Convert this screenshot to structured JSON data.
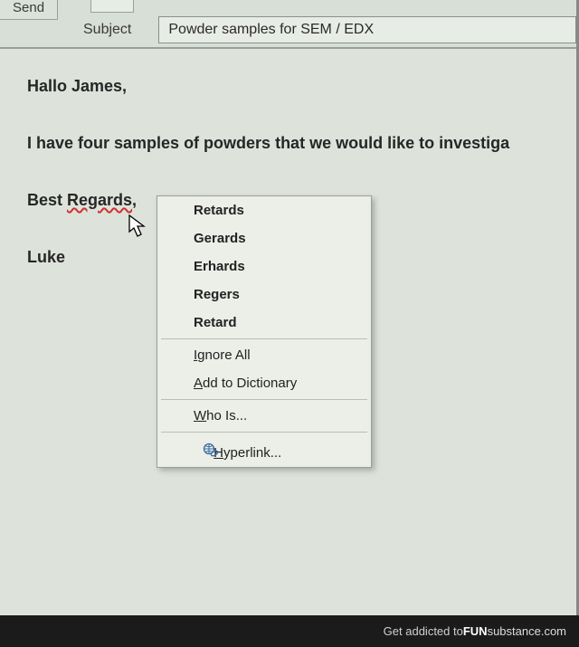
{
  "header": {
    "send_label": "Send",
    "subject_label": "Subject",
    "subject_value": "Powder samples for SEM / EDX"
  },
  "body": {
    "greeting": "Hallo James,",
    "paragraph": "I have four samples of powders that we would like to investiga",
    "closing_prefix": "Best ",
    "closing_misspelled": "Regards",
    "closing_suffix": ",",
    "signature": "Luke"
  },
  "menu": {
    "suggestions": [
      "Retards",
      "Gerards",
      "Erhards",
      "Regers",
      "Retard"
    ],
    "ignore": "Ignore All",
    "add_dict": "Add to Dictionary",
    "whois": "Who Is...",
    "hyperlink": "Hyperlink..."
  },
  "footer": {
    "lead": "Get addicted to ",
    "brand": "FUN",
    "sub": "substance",
    "dot": ".com"
  }
}
